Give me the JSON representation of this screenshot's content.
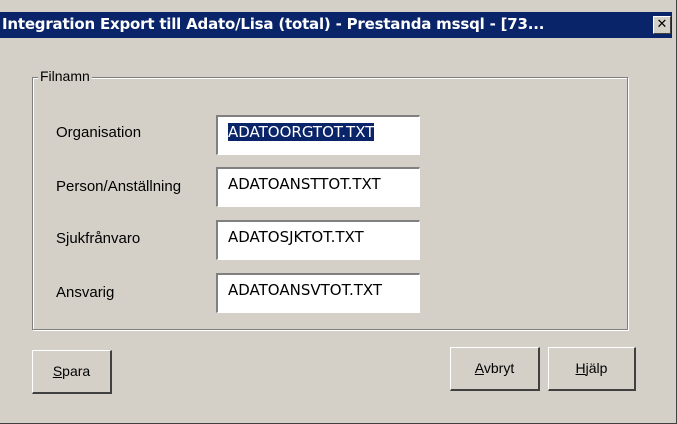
{
  "window": {
    "title": "Integration Export till Adato/Lisa (total) - Prestanda mssql - [73...",
    "close_glyph": "✕"
  },
  "group": {
    "legend": "Filnamn",
    "rows": [
      {
        "label": "Organisation",
        "value": "ADATOORGTOT.TXT",
        "selected": true
      },
      {
        "label": "Person/Anställning",
        "value": "ADATOANSTTOT.TXT",
        "selected": false
      },
      {
        "label": "Sjukfrånvaro",
        "value": "ADATOSJKTOT.TXT",
        "selected": false
      },
      {
        "label": "Ansvarig",
        "value": "ADATOANSVTOT.TXT",
        "selected": false
      }
    ]
  },
  "buttons": {
    "save": {
      "mnemonic": "S",
      "rest": "para"
    },
    "cancel": {
      "mnemonic": "A",
      "rest": "vbryt"
    },
    "help": {
      "mnemonic": "H",
      "rest": "jälp"
    }
  },
  "colors": {
    "titlebar": "#0a246a",
    "face": "#d4d0c8",
    "selection": "#0a246a"
  }
}
